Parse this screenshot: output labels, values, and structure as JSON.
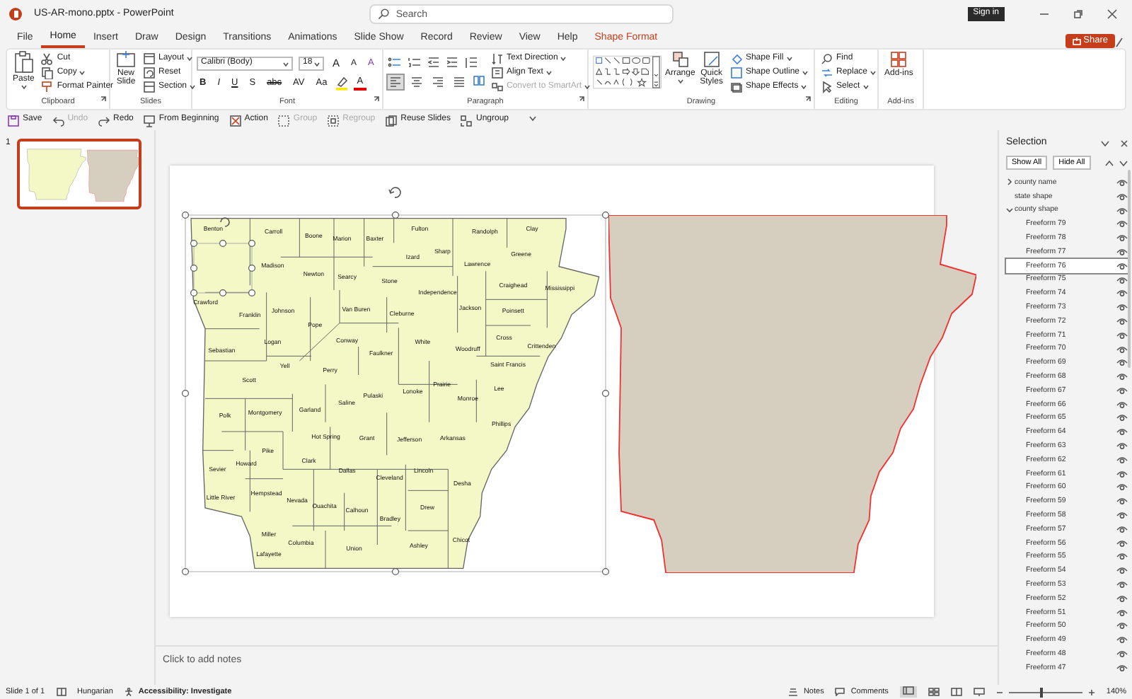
{
  "window": {
    "title": "US-AR-mono.pptx - PowerPoint",
    "search": {
      "placeholder": "Search"
    },
    "sign_in": "Sign in"
  },
  "tabs": [
    {
      "label": "File",
      "selected": false,
      "kind": "standard"
    },
    {
      "label": "Home",
      "selected": true,
      "kind": "standard"
    },
    {
      "label": "Insert",
      "selected": false,
      "kind": "standard"
    },
    {
      "label": "Draw",
      "selected": false,
      "kind": "standard"
    },
    {
      "label": "Design",
      "selected": false,
      "kind": "standard"
    },
    {
      "label": "Transitions",
      "selected": false,
      "kind": "standard"
    },
    {
      "label": "Animations",
      "selected": false,
      "kind": "standard"
    },
    {
      "label": "Slide Show",
      "selected": false,
      "kind": "standard"
    },
    {
      "label": "Record",
      "selected": false,
      "kind": "standard"
    },
    {
      "label": "Review",
      "selected": false,
      "kind": "standard"
    },
    {
      "label": "View",
      "selected": false,
      "kind": "standard"
    },
    {
      "label": "Help",
      "selected": false,
      "kind": "standard"
    },
    {
      "label": "Shape Format",
      "selected": false,
      "kind": "contextual"
    }
  ],
  "share": "Share",
  "ribbon": {
    "clipboard": {
      "label": "Clipboard",
      "paste": "Paste",
      "commands": [
        "Cut",
        "Copy",
        "Format Painter"
      ]
    },
    "slides": {
      "label": "Slides",
      "new_slide": "New Slide",
      "commands": [
        {
          "label": "Layout",
          "dropdown": true
        },
        {
          "label": "Reset",
          "dropdown": false
        },
        {
          "label": "Section",
          "dropdown": true
        }
      ]
    },
    "font": {
      "label": "Font",
      "font_name": "Calibri (Body)",
      "font_size": "18",
      "size_buttons": [
        "A",
        "A"
      ],
      "clear_formatting": "A",
      "style_buttons": [
        "B",
        "I",
        "U",
        "S",
        "abc",
        "AV",
        "Aa"
      ],
      "font_color": "A"
    },
    "paragraph": {
      "label": "Paragraph",
      "alignment": [
        {
          "selected": true
        },
        {
          "selected": false
        },
        {
          "selected": false
        },
        {
          "selected": false
        }
      ],
      "commands": [
        {
          "label": "Text Direction",
          "disabled": false
        },
        {
          "label": "Align Text",
          "disabled": false
        },
        {
          "label": "Convert to SmartArt",
          "disabled": true
        }
      ]
    },
    "drawing": {
      "label": "Drawing",
      "arrange": "Arrange",
      "quick_styles": "Quick Styles",
      "commands": [
        "Shape Fill",
        "Shape Outline",
        "Shape Effects"
      ]
    },
    "editing": {
      "label": "Editing",
      "commands": [
        "Find",
        "Replace",
        "Select"
      ]
    },
    "addins": {
      "label": "Add-ins",
      "button": "Add-ins"
    }
  },
  "quick_access": [
    {
      "label": "Save",
      "disabled": false
    },
    {
      "label": "Undo",
      "disabled": true
    },
    {
      "label": "Redo",
      "disabled": false
    },
    {
      "label": "From Beginning",
      "disabled": false
    },
    {
      "label": "Action",
      "disabled": false
    },
    {
      "label": "Group",
      "disabled": true
    },
    {
      "label": "Regroup",
      "disabled": true
    },
    {
      "label": "Reuse Slides",
      "disabled": false
    },
    {
      "label": "Ungroup",
      "disabled": false
    }
  ],
  "thumbnails": [
    {
      "number": "1",
      "selected": true
    }
  ],
  "slide": {
    "county_labels": [
      "Benton",
      "Carroll",
      "Boone",
      "Marion",
      "Baxter",
      "Fulton",
      "Randolph",
      "Clay",
      "Madison",
      "Newton",
      "Searcy",
      "Izard",
      "Sharp",
      "Lawrence",
      "Greene",
      "Stone",
      "Independence",
      "Craighead",
      "Mississippi",
      "Crawford",
      "Franklin",
      "Johnson",
      "Van Buren",
      "Cleburne",
      "Jackson",
      "Poinsett",
      "Pope",
      "Logan",
      "Conway",
      "White",
      "Woodruff",
      "Cross",
      "Crittenden",
      "Sebastian",
      "Faulkner",
      "Yell",
      "Perry",
      "Saint Francis",
      "Scott",
      "Pulaski",
      "Lonoke",
      "Prairie",
      "Lee",
      "Monroe",
      "Polk",
      "Montgomery",
      "Garland",
      "Saline",
      "Phillips",
      "Hot Spring",
      "Grant",
      "Jefferson",
      "Arkansas",
      "Pike",
      "Howard",
      "Sevier",
      "Clark",
      "Dallas",
      "Cleveland",
      "Lincoln",
      "Desha",
      "Little River",
      "Hempstead",
      "Nevada",
      "Ouachita",
      "Calhoun",
      "Bradley",
      "Drew",
      "Miller",
      "Lafayette",
      "Columbia",
      "Union",
      "Ashley",
      "Chicot"
    ]
  },
  "notes": {
    "placeholder": "Click to add notes"
  },
  "selection_pane": {
    "title": "Selection",
    "buttons": [
      "Show All",
      "Hide All"
    ],
    "items": [
      {
        "label": "county name",
        "kind": "group",
        "expanded": false,
        "selected": false
      },
      {
        "label": "state shape",
        "kind": "shape",
        "selected": false
      },
      {
        "label": "county shape",
        "kind": "group",
        "expanded": true,
        "selected": false,
        "children": [
          {
            "label": "Freeform 79",
            "selected": false
          },
          {
            "label": "Freeform 78",
            "selected": false
          },
          {
            "label": "Freeform 77",
            "selected": false
          },
          {
            "label": "Freeform 76",
            "selected": true
          },
          {
            "label": "Freeform 75",
            "selected": false
          },
          {
            "label": "Freeform 74",
            "selected": false
          },
          {
            "label": "Freeform 73",
            "selected": false
          },
          {
            "label": "Freeform 72",
            "selected": false
          },
          {
            "label": "Freeform 71",
            "selected": false
          },
          {
            "label": "Freeform 70",
            "selected": false
          },
          {
            "label": "Freeform 69",
            "selected": false
          },
          {
            "label": "Freeform 68",
            "selected": false
          },
          {
            "label": "Freeform 67",
            "selected": false
          },
          {
            "label": "Freeform 66",
            "selected": false
          },
          {
            "label": "Freeform 65",
            "selected": false
          },
          {
            "label": "Freeform 64",
            "selected": false
          },
          {
            "label": "Freeform 63",
            "selected": false
          },
          {
            "label": "Freeform 62",
            "selected": false
          },
          {
            "label": "Freeform 61",
            "selected": false
          },
          {
            "label": "Freeform 60",
            "selected": false
          },
          {
            "label": "Freeform 59",
            "selected": false
          },
          {
            "label": "Freeform 58",
            "selected": false
          },
          {
            "label": "Freeform 57",
            "selected": false
          },
          {
            "label": "Freeform 56",
            "selected": false
          },
          {
            "label": "Freeform 55",
            "selected": false
          },
          {
            "label": "Freeform 54",
            "selected": false
          },
          {
            "label": "Freeform 53",
            "selected": false
          },
          {
            "label": "Freeform 52",
            "selected": false
          },
          {
            "label": "Freeform 51",
            "selected": false
          },
          {
            "label": "Freeform 50",
            "selected": false
          },
          {
            "label": "Freeform 49",
            "selected": false
          },
          {
            "label": "Freeform 48",
            "selected": false
          },
          {
            "label": "Freeform 47",
            "selected": false
          }
        ]
      }
    ]
  },
  "status_bar": {
    "slide": "Slide 1 of 1",
    "language": "Hungarian",
    "accessibility": "Accessibility: Investigate",
    "notes": "Notes",
    "comments": "Comments",
    "zoom": {
      "level": 0.42,
      "reading": "140%"
    }
  }
}
